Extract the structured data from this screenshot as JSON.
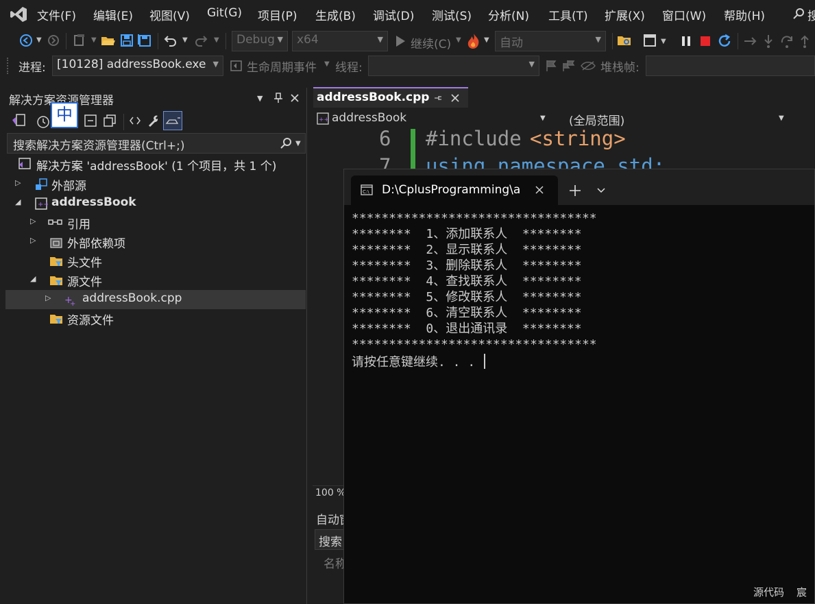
{
  "menu": [
    "文件(F)",
    "编辑(E)",
    "视图(V)",
    "Git(G)",
    "项目(P)",
    "生成(B)",
    "调试(D)",
    "测试(S)",
    "分析(N)",
    "工具(T)",
    "扩展(X)",
    "窗口(W)",
    "帮助(H)"
  ],
  "menu_extra": "搜",
  "toolbar": {
    "config": "Debug",
    "platform": "x64",
    "continue_label": "继续(C)",
    "auto_label": "自动"
  },
  "toolbar2": {
    "process_label": "进程:",
    "process_value": "[10128] addressBook.exe",
    "lifecycle_label": "生命周期事件",
    "thread_label": "线程:",
    "stack_label": "堆栈帧:"
  },
  "solution_explorer": {
    "title": "解决方案资源管理器",
    "search_placeholder": "搜索解决方案资源管理器(Ctrl+;)",
    "items": [
      {
        "label": "解决方案 'addressBook' (1 个项目，共 1 个)",
        "bold": false
      },
      {
        "label": "外部源",
        "bold": false
      },
      {
        "label": "addressBook",
        "bold": true
      },
      {
        "label": "引用",
        "bold": false
      },
      {
        "label": "外部依赖项",
        "bold": false
      },
      {
        "label": "头文件",
        "bold": false
      },
      {
        "label": "源文件",
        "bold": false
      },
      {
        "label": "addressBook.cpp",
        "bold": false
      },
      {
        "label": "资源文件",
        "bold": false
      }
    ]
  },
  "ime_indicator": "中",
  "editor": {
    "tab_label": "addressBook.cpp",
    "nav_left": "addressBook",
    "nav_right": "(全局范围)",
    "lines": [
      {
        "num": "6",
        "text_a": "#include",
        "text_b": "<string>"
      },
      {
        "num": "7",
        "text_a": "using namespace std;",
        "text_b": ""
      }
    ],
    "zoom": "100 %"
  },
  "autos": {
    "title": "自动窗",
    "search": "搜索",
    "column": "名称"
  },
  "terminal": {
    "tab_title": "D:\\CplusProgramming\\a",
    "lines": [
      "*********************************",
      "********  1、添加联系人  ********",
      "********  2、显示联系人  ********",
      "********  3、删除联系人  ********",
      "********  4、查找联系人  ********",
      "********  5、修改联系人  ********",
      "********  6、清空联系人  ********",
      "********  0、退出通讯录  ********",
      "*********************************"
    ],
    "prompt": "请按任意键继续. . . "
  },
  "bottom_right": {
    "source_label": "源代码",
    "extra": "宸"
  },
  "colors": {
    "accent": "#a07be0",
    "git_bar": "#3fa53f"
  }
}
